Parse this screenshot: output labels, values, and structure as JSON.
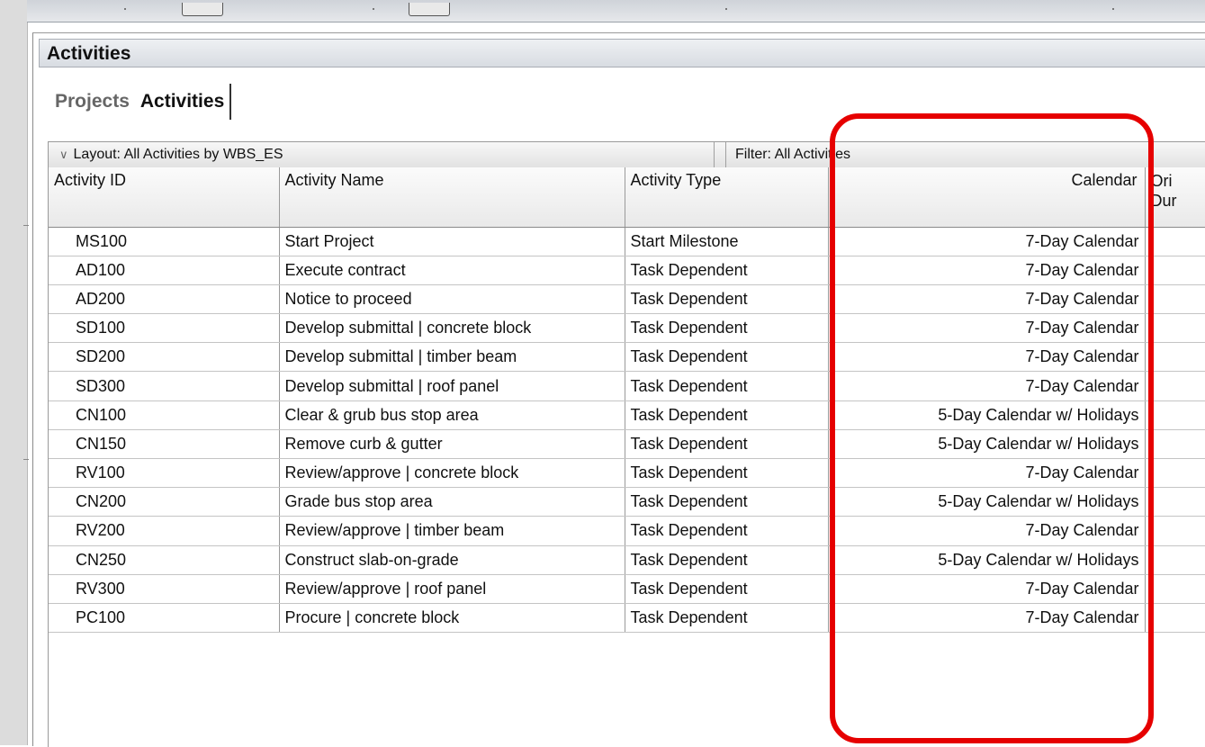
{
  "panel": {
    "title": "Activities"
  },
  "tabs": [
    {
      "label": "Projects",
      "active": false
    },
    {
      "label": "Activities",
      "active": true
    }
  ],
  "layout_bar": {
    "layout_label": "Layout: All Activities by WBS_ES",
    "filter_label": "Filter: All Activities"
  },
  "columns": {
    "activity_id": "Activity ID",
    "activity_name": "Activity Name",
    "activity_type": "Activity Type",
    "calendar": "Calendar",
    "original_duration_line1": "Ori",
    "original_duration_line2": "Dur"
  },
  "rows": [
    {
      "id": "MS100",
      "name": "Start Project",
      "type": "Start Milestone",
      "calendar": "7-Day Calendar"
    },
    {
      "id": "AD100",
      "name": "Execute contract",
      "type": "Task Dependent",
      "calendar": "7-Day Calendar"
    },
    {
      "id": "AD200",
      "name": "Notice to proceed",
      "type": "Task Dependent",
      "calendar": "7-Day Calendar"
    },
    {
      "id": "SD100",
      "name": "Develop submittal | concrete block",
      "type": "Task Dependent",
      "calendar": "7-Day Calendar"
    },
    {
      "id": "SD200",
      "name": "Develop submittal | timber beam",
      "type": "Task Dependent",
      "calendar": "7-Day Calendar"
    },
    {
      "id": "SD300",
      "name": "Develop submittal | roof panel",
      "type": "Task Dependent",
      "calendar": "7-Day Calendar"
    },
    {
      "id": "CN100",
      "name": "Clear & grub bus stop area",
      "type": "Task Dependent",
      "calendar": "5-Day Calendar w/ Holidays"
    },
    {
      "id": "CN150",
      "name": "Remove curb & gutter",
      "type": "Task Dependent",
      "calendar": "5-Day Calendar w/ Holidays"
    },
    {
      "id": "RV100",
      "name": "Review/approve | concrete block",
      "type": "Task Dependent",
      "calendar": "7-Day Calendar"
    },
    {
      "id": "CN200",
      "name": "Grade bus stop area",
      "type": "Task Dependent",
      "calendar": "5-Day Calendar w/ Holidays"
    },
    {
      "id": "RV200",
      "name": "Review/approve | timber beam",
      "type": "Task Dependent",
      "calendar": "7-Day Calendar"
    },
    {
      "id": "CN250",
      "name": "Construct slab-on-grade",
      "type": "Task Dependent",
      "calendar": "5-Day Calendar w/ Holidays"
    },
    {
      "id": "RV300",
      "name": "Review/approve | roof panel",
      "type": "Task Dependent",
      "calendar": "7-Day Calendar"
    },
    {
      "id": "PC100",
      "name": "Procure | concrete block",
      "type": "Task Dependent",
      "calendar": "7-Day Calendar"
    }
  ],
  "colors": {
    "highlight": "#e60000"
  },
  "icons": {
    "layout_toggle": "chevron-down-icon"
  }
}
